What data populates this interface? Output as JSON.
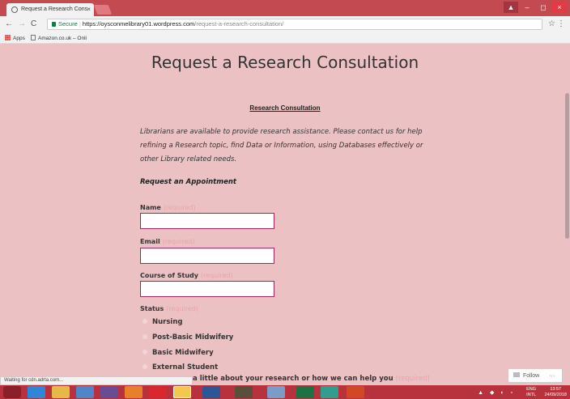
{
  "browser": {
    "tab_title": "Request a Research Cons",
    "tab_close": "×",
    "url_secure": "Secure",
    "url_host": "https://oysconmelibrary01.wordpress.com",
    "url_path": "/request-a-research-consultation/",
    "back": "←",
    "forward": "→",
    "reload": "C",
    "star": "☆",
    "menu": "⋮",
    "win_min": "–",
    "win_max": "◻",
    "win_close": "×"
  },
  "bookmarks": [
    {
      "label": "Apps"
    },
    {
      "label": "Amazon.co.uk – Onli"
    }
  ],
  "page": {
    "title": "Request a Research Consultation",
    "section_title": "Research Consultation",
    "intro": "Librarians are available to provide research assistance. Please contact us for help refining a Research topic, find Data or Information, using Databases effectively or other Library related needs.",
    "appointment_heading": "Request an Appointment",
    "required_text": "(required)",
    "fields": {
      "name_label": "Name",
      "email_label": "Email",
      "course_label": "Course of Study",
      "status_label": "Status"
    },
    "status_options": [
      "Nursing",
      "Post-Basic Midwifery",
      "Basic Midwifery",
      "External Student"
    ],
    "tell_us": "a little about your research or how we can help you",
    "follow": "Follow",
    "follow_more": "···"
  },
  "status_bar": "Waiting for cdn.adrta.com...",
  "taskbar": {
    "lang_top": "ENG",
    "lang_bottom": "INTL",
    "time": "13:57",
    "date": "24/09/2018",
    "tray_icons": "▲ ◆ ◐ ▫"
  },
  "colors": {
    "page_bg": "#ecc1c4",
    "input_border": "#a0245e",
    "required": "#e9a3a8",
    "titlebar": "#c44a52",
    "taskbar": "#b7323d"
  }
}
